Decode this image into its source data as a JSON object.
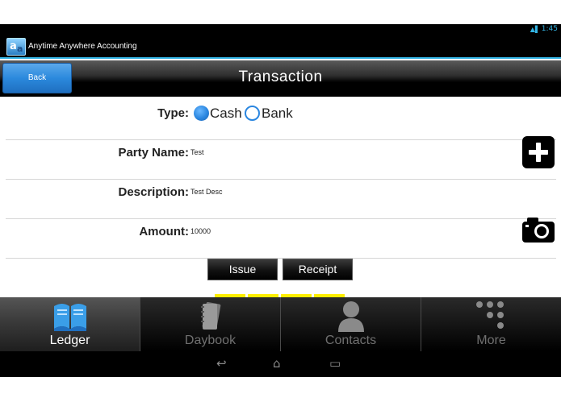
{
  "status_bar": {
    "icons": "▲▌",
    "time": "1:45"
  },
  "app_bar": {
    "title": "Anytime Anywhere Accounting"
  },
  "header": {
    "back_label": "Back",
    "title": "Transaction"
  },
  "form": {
    "type": {
      "label": "Type:",
      "options": [
        {
          "label": "Cash",
          "selected": true
        },
        {
          "label": "Bank",
          "selected": false
        }
      ]
    },
    "party_name": {
      "label": "Party Name:",
      "value": "Test"
    },
    "description": {
      "label": "Description:",
      "value": "Test Desc"
    },
    "amount": {
      "label": "Amount:",
      "value": "10000"
    },
    "buttons": {
      "issue": "Issue",
      "receipt": "Receipt"
    }
  },
  "bottom_nav": [
    {
      "label": "Ledger",
      "active": true,
      "icon": "book-icon"
    },
    {
      "label": "Daybook",
      "active": false,
      "icon": "notebook-icon"
    },
    {
      "label": "Contacts",
      "active": false,
      "icon": "person-icon"
    },
    {
      "label": "More",
      "active": false,
      "icon": "dots-grid-icon"
    }
  ],
  "system_nav": {
    "back": "↩",
    "home": "⌂",
    "recents": "▭"
  },
  "colors": {
    "accent": "#33b5e5",
    "radio": "#2a86e0",
    "page_indicator": "#ffee00"
  }
}
